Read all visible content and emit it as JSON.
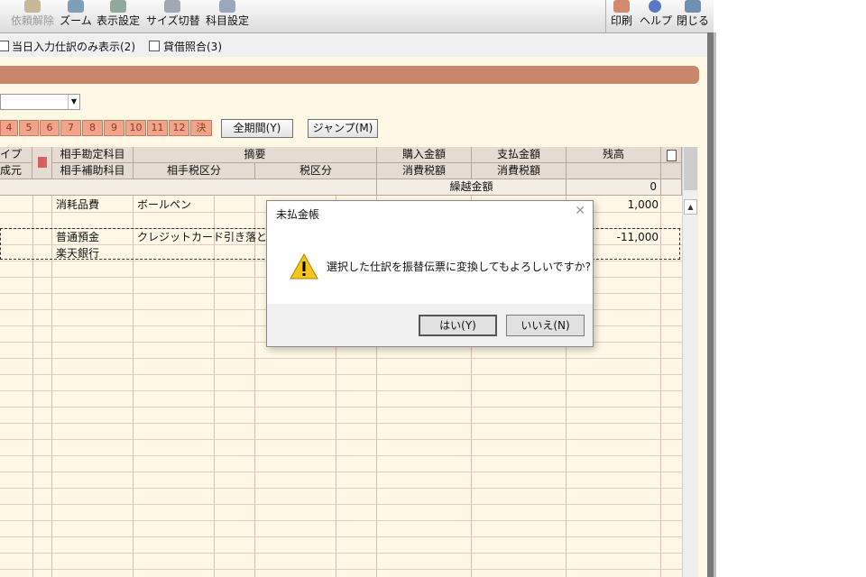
{
  "toolbar": {
    "items": [
      {
        "label": "依頼解除",
        "icon": "stamp-icon"
      },
      {
        "label": "ズーム",
        "icon": "zoom-icon"
      },
      {
        "label": "表示設定",
        "icon": "display-settings-icon"
      },
      {
        "label": "サイズ切替",
        "icon": "resize-icon"
      },
      {
        "label": "科目設定",
        "icon": "account-settings-icon"
      }
    ],
    "right_items": [
      {
        "label": "印刷",
        "icon": "printer-icon"
      },
      {
        "label": "ヘルプ",
        "icon": "help-icon"
      },
      {
        "label": "閉じる",
        "icon": "close-door-icon"
      }
    ]
  },
  "options": {
    "today_only": "当日入力仕訳のみ表示(2)",
    "reconcile": "貸借照合(3)"
  },
  "months": [
    "4",
    "5",
    "6",
    "7",
    "8",
    "9",
    "10",
    "11",
    "12",
    "決"
  ],
  "buttons": {
    "all_period": "全期間(Y)",
    "jump": "ジャンプ(M)"
  },
  "table": {
    "header_row1": {
      "type": "イプ",
      "account": "相手勘定科目",
      "summary": "摘要",
      "purchase": "購入金額",
      "payment": "支払金額",
      "balance": "残高"
    },
    "header_row2": {
      "source": "成元",
      "sub_account": "相手補助科目",
      "tax_class_partner": "相手税区分",
      "tax_class": "税区分",
      "tax_purchase": "消費税額",
      "tax_payment": "消費税額"
    },
    "carry_over_label": "繰越金額",
    "carry_over_value": "0",
    "rows": [
      {
        "account": "消耗品費",
        "summary": "ボールペン",
        "balance": "1,000"
      },
      {
        "account": "普通預金",
        "sub_account": "楽天銀行",
        "summary": "クレジットカード引き落とし(1月",
        "balance": "-11,000"
      }
    ]
  },
  "dialog": {
    "title": "未払金帳",
    "message": "選択した仕訳を振替伝票に変換してもよろしいですか?",
    "yes": "はい(Y)",
    "no": "いいえ(N)"
  },
  "colors": {
    "accent_bar": "#c9866a",
    "month_tab": "#f2a48a",
    "background": "#fff8e7"
  }
}
